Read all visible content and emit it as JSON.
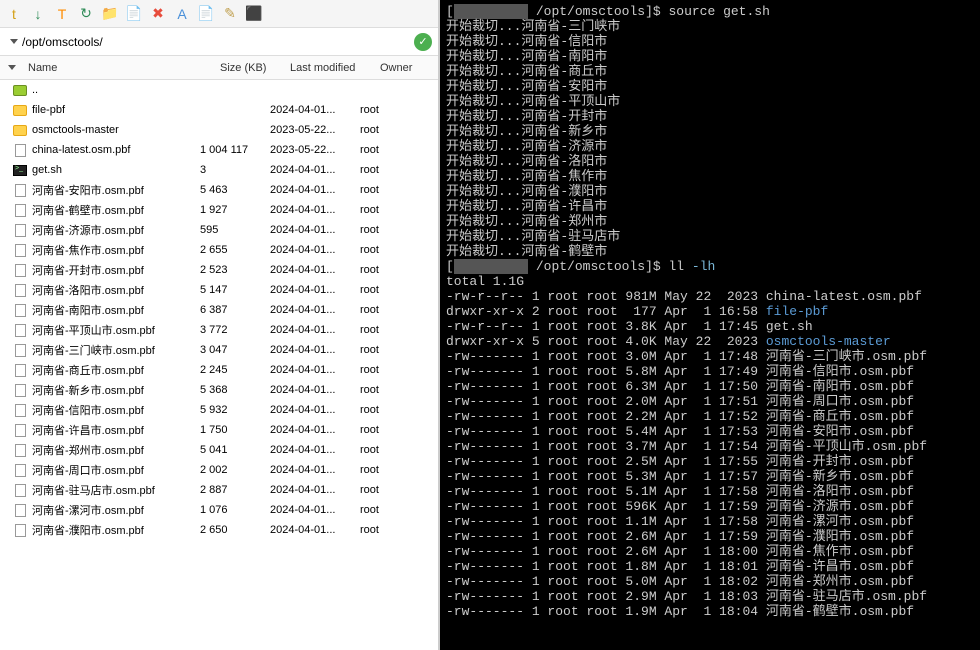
{
  "path": "/opt/omsctools/",
  "columns": {
    "name": "Name",
    "size": "Size (KB)",
    "modified": "Last modified",
    "owner": "Owner"
  },
  "rows": [
    {
      "type": "up",
      "name": "..",
      "size": "",
      "mod": "",
      "owner": ""
    },
    {
      "type": "folder",
      "name": "file-pbf",
      "size": "",
      "mod": "2024-04-01...",
      "owner": "root"
    },
    {
      "type": "folder",
      "name": "osmctools-master",
      "size": "",
      "mod": "2023-05-22...",
      "owner": "root"
    },
    {
      "type": "file",
      "name": "china-latest.osm.pbf",
      "size": "1 004 117",
      "mod": "2023-05-22...",
      "owner": "root"
    },
    {
      "type": "sh",
      "name": "get.sh",
      "size": "3",
      "mod": "2024-04-01...",
      "owner": "root"
    },
    {
      "type": "file",
      "name": "河南省-安阳市.osm.pbf",
      "size": "5 463",
      "mod": "2024-04-01...",
      "owner": "root"
    },
    {
      "type": "file",
      "name": "河南省-鹤壁市.osm.pbf",
      "size": "1 927",
      "mod": "2024-04-01...",
      "owner": "root"
    },
    {
      "type": "file",
      "name": "河南省-济源市.osm.pbf",
      "size": "595",
      "mod": "2024-04-01...",
      "owner": "root"
    },
    {
      "type": "file",
      "name": "河南省-焦作市.osm.pbf",
      "size": "2 655",
      "mod": "2024-04-01...",
      "owner": "root"
    },
    {
      "type": "file",
      "name": "河南省-开封市.osm.pbf",
      "size": "2 523",
      "mod": "2024-04-01...",
      "owner": "root"
    },
    {
      "type": "file",
      "name": "河南省-洛阳市.osm.pbf",
      "size": "5 147",
      "mod": "2024-04-01...",
      "owner": "root"
    },
    {
      "type": "file",
      "name": "河南省-南阳市.osm.pbf",
      "size": "6 387",
      "mod": "2024-04-01...",
      "owner": "root"
    },
    {
      "type": "file",
      "name": "河南省-平顶山市.osm.pbf",
      "size": "3 772",
      "mod": "2024-04-01...",
      "owner": "root"
    },
    {
      "type": "file",
      "name": "河南省-三门峡市.osm.pbf",
      "size": "3 047",
      "mod": "2024-04-01...",
      "owner": "root"
    },
    {
      "type": "file",
      "name": "河南省-商丘市.osm.pbf",
      "size": "2 245",
      "mod": "2024-04-01...",
      "owner": "root"
    },
    {
      "type": "file",
      "name": "河南省-新乡市.osm.pbf",
      "size": "5 368",
      "mod": "2024-04-01...",
      "owner": "root"
    },
    {
      "type": "file",
      "name": "河南省-信阳市.osm.pbf",
      "size": "5 932",
      "mod": "2024-04-01...",
      "owner": "root"
    },
    {
      "type": "file",
      "name": "河南省-许昌市.osm.pbf",
      "size": "1 750",
      "mod": "2024-04-01...",
      "owner": "root"
    },
    {
      "type": "file",
      "name": "河南省-郑州市.osm.pbf",
      "size": "5 041",
      "mod": "2024-04-01...",
      "owner": "root"
    },
    {
      "type": "file",
      "name": "河南省-周口市.osm.pbf",
      "size": "2 002",
      "mod": "2024-04-01...",
      "owner": "root"
    },
    {
      "type": "file",
      "name": "河南省-驻马店市.osm.pbf",
      "size": "2 887",
      "mod": "2024-04-01...",
      "owner": "root"
    },
    {
      "type": "file",
      "name": "河南省-漯河市.osm.pbf",
      "size": "1 076",
      "mod": "2024-04-01...",
      "owner": "root"
    },
    {
      "type": "file",
      "name": "河南省-濮阳市.osm.pbf",
      "size": "2 650",
      "mod": "2024-04-01...",
      "owner": "root"
    }
  ],
  "term": {
    "prompt_host": "         ",
    "prompt_path": "/opt/omsctools",
    "cmd1": "source get.sh",
    "cutting": "开始裁切...",
    "cities": [
      "河南省-三门峡市",
      "河南省-信阳市",
      "河南省-南阳市",
      "河南省-商丘市",
      "河南省-安阳市",
      "河南省-平顶山市",
      "河南省-开封市",
      "河南省-新乡市",
      "河南省-济源市",
      "河南省-洛阳市",
      "河南省-焦作市",
      "河南省-濮阳市",
      "河南省-许昌市",
      "河南省-郑州市",
      "河南省-驻马店市",
      "河南省-鹤壁市"
    ],
    "cmd2": "ll",
    "cmd2_opt": "-lh",
    "total": "total 1.1G",
    "ls": [
      {
        "perm": "-rw-r--r--",
        "links": "1",
        "own": "root root",
        "size": "981M",
        "date": "May 22  2023",
        "name": "china-latest.osm.pbf",
        "dir": false
      },
      {
        "perm": "drwxr-xr-x",
        "links": "2",
        "own": "root root",
        "size": " 177",
        "date": "Apr  1 16:58",
        "name": "file-pbf",
        "dir": true
      },
      {
        "perm": "-rw-r--r--",
        "links": "1",
        "own": "root root",
        "size": "3.8K",
        "date": "Apr  1 17:45",
        "name": "get.sh",
        "dir": false
      },
      {
        "perm": "drwxr-xr-x",
        "links": "5",
        "own": "root root",
        "size": "4.0K",
        "date": "May 22  2023",
        "name": "osmctools-master",
        "dir": true
      },
      {
        "perm": "-rw-------",
        "links": "1",
        "own": "root root",
        "size": "3.0M",
        "date": "Apr  1 17:48",
        "name": "河南省-三门峡市.osm.pbf",
        "dir": false
      },
      {
        "perm": "-rw-------",
        "links": "1",
        "own": "root root",
        "size": "5.8M",
        "date": "Apr  1 17:49",
        "name": "河南省-信阳市.osm.pbf",
        "dir": false
      },
      {
        "perm": "-rw-------",
        "links": "1",
        "own": "root root",
        "size": "6.3M",
        "date": "Apr  1 17:50",
        "name": "河南省-南阳市.osm.pbf",
        "dir": false
      },
      {
        "perm": "-rw-------",
        "links": "1",
        "own": "root root",
        "size": "2.0M",
        "date": "Apr  1 17:51",
        "name": "河南省-周口市.osm.pbf",
        "dir": false
      },
      {
        "perm": "-rw-------",
        "links": "1",
        "own": "root root",
        "size": "2.2M",
        "date": "Apr  1 17:52",
        "name": "河南省-商丘市.osm.pbf",
        "dir": false
      },
      {
        "perm": "-rw-------",
        "links": "1",
        "own": "root root",
        "size": "5.4M",
        "date": "Apr  1 17:53",
        "name": "河南省-安阳市.osm.pbf",
        "dir": false
      },
      {
        "perm": "-rw-------",
        "links": "1",
        "own": "root root",
        "size": "3.7M",
        "date": "Apr  1 17:54",
        "name": "河南省-平顶山市.osm.pbf",
        "dir": false
      },
      {
        "perm": "-rw-------",
        "links": "1",
        "own": "root root",
        "size": "2.5M",
        "date": "Apr  1 17:55",
        "name": "河南省-开封市.osm.pbf",
        "dir": false
      },
      {
        "perm": "-rw-------",
        "links": "1",
        "own": "root root",
        "size": "5.3M",
        "date": "Apr  1 17:57",
        "name": "河南省-新乡市.osm.pbf",
        "dir": false
      },
      {
        "perm": "-rw-------",
        "links": "1",
        "own": "root root",
        "size": "5.1M",
        "date": "Apr  1 17:58",
        "name": "河南省-洛阳市.osm.pbf",
        "dir": false
      },
      {
        "perm": "-rw-------",
        "links": "1",
        "own": "root root",
        "size": "596K",
        "date": "Apr  1 17:59",
        "name": "河南省-济源市.osm.pbf",
        "dir": false
      },
      {
        "perm": "-rw-------",
        "links": "1",
        "own": "root root",
        "size": "1.1M",
        "date": "Apr  1 17:58",
        "name": "河南省-漯河市.osm.pbf",
        "dir": false
      },
      {
        "perm": "-rw-------",
        "links": "1",
        "own": "root root",
        "size": "2.6M",
        "date": "Apr  1 17:59",
        "name": "河南省-濮阳市.osm.pbf",
        "dir": false
      },
      {
        "perm": "-rw-------",
        "links": "1",
        "own": "root root",
        "size": "2.6M",
        "date": "Apr  1 18:00",
        "name": "河南省-焦作市.osm.pbf",
        "dir": false
      },
      {
        "perm": "-rw-------",
        "links": "1",
        "own": "root root",
        "size": "1.8M",
        "date": "Apr  1 18:01",
        "name": "河南省-许昌市.osm.pbf",
        "dir": false
      },
      {
        "perm": "-rw-------",
        "links": "1",
        "own": "root root",
        "size": "5.0M",
        "date": "Apr  1 18:02",
        "name": "河南省-郑州市.osm.pbf",
        "dir": false
      },
      {
        "perm": "-rw-------",
        "links": "1",
        "own": "root root",
        "size": "2.9M",
        "date": "Apr  1 18:03",
        "name": "河南省-驻马店市.osm.pbf",
        "dir": false
      },
      {
        "perm": "-rw-------",
        "links": "1",
        "own": "root root",
        "size": "1.9M",
        "date": "Apr  1 18:04",
        "name": "河南省-鹤壁市.osm.pbf",
        "dir": false
      }
    ]
  },
  "toolbar_icons": [
    "t",
    "↓",
    "T",
    "↻",
    "📁",
    "📄",
    "✖",
    "A",
    "📄",
    "✎",
    "⬛"
  ]
}
